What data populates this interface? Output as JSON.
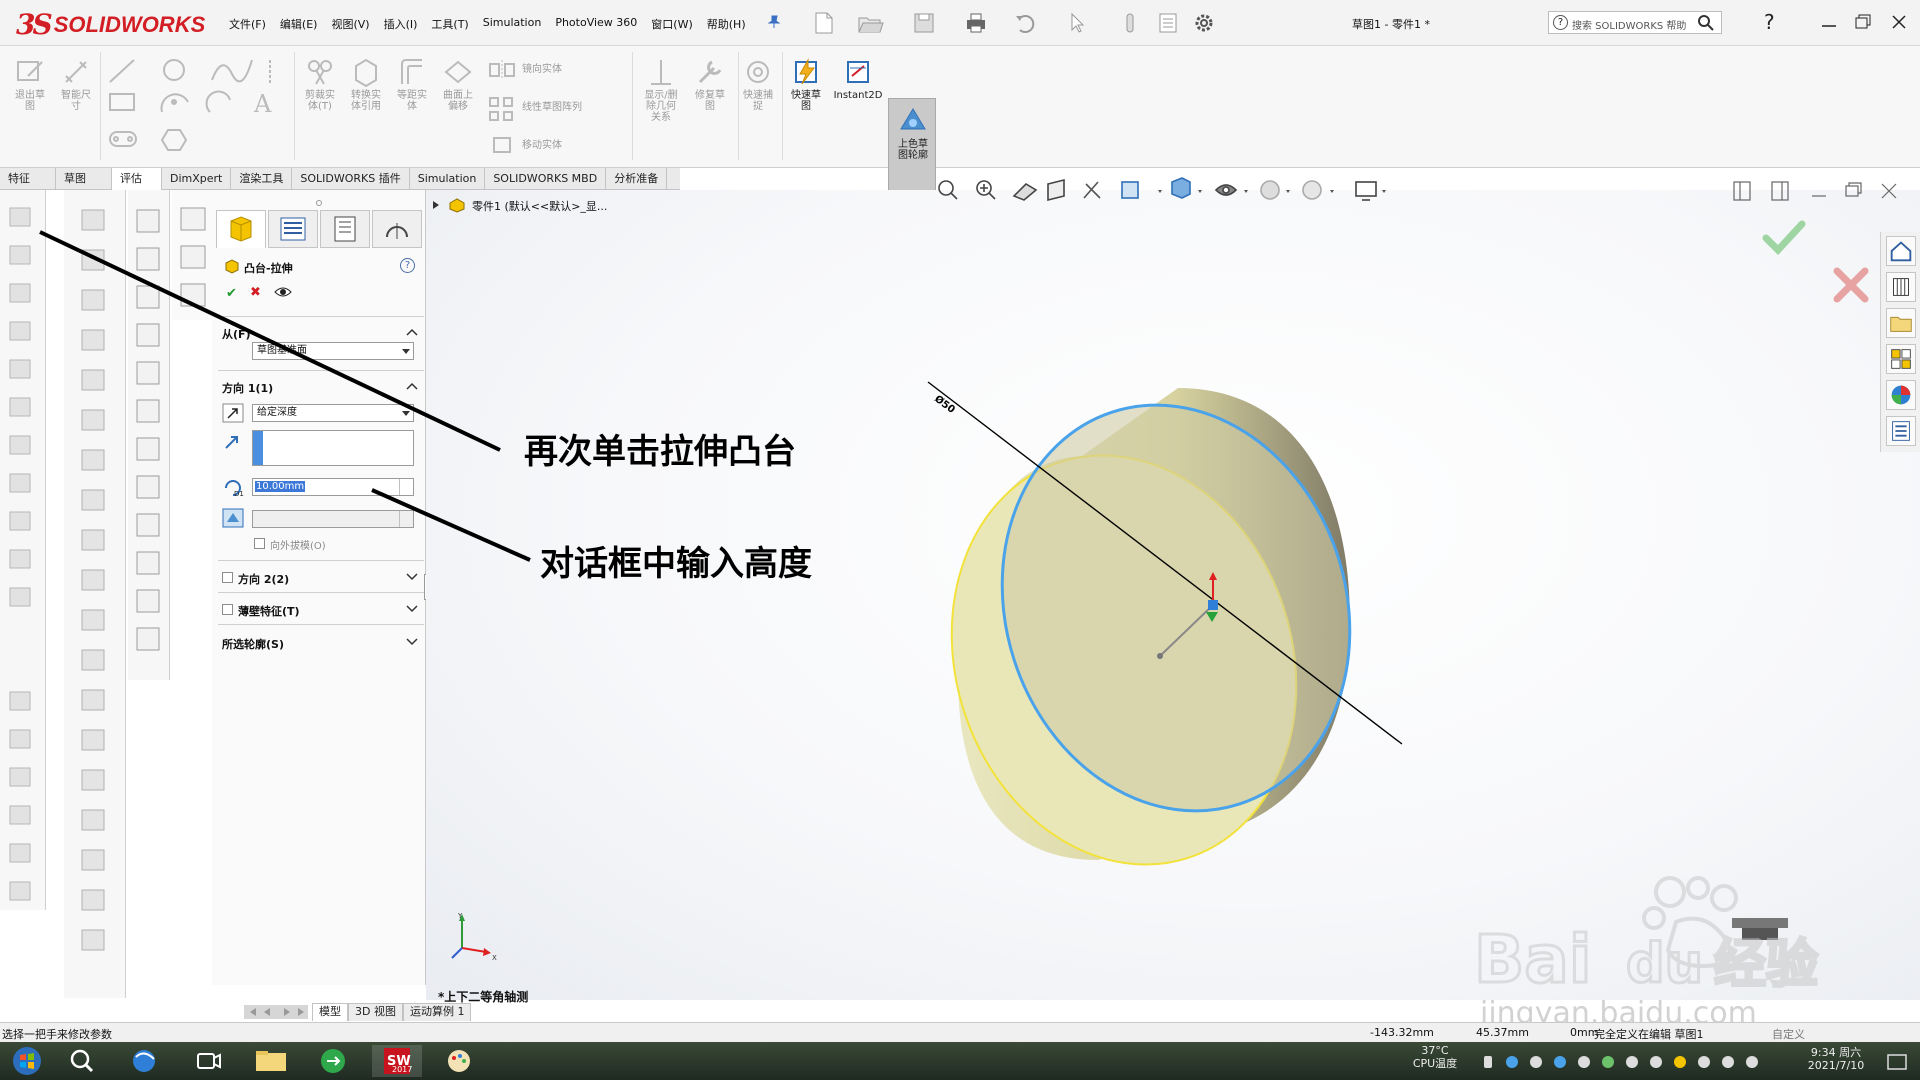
{
  "app": {
    "logo_text": "SOLIDWORKS",
    "document_title": "草图1 - 零件1 *"
  },
  "menu": [
    "文件(F)",
    "编辑(E)",
    "视图(V)",
    "插入(I)",
    "工具(T)",
    "Simulation",
    "PhotoView 360",
    "窗口(W)",
    "帮助(H)"
  ],
  "search": {
    "placeholder": "搜索 SOLIDWORKS 帮助"
  },
  "command_manager": {
    "buttons": [
      {
        "label": "退出草\n图"
      },
      {
        "label": "智能尺\n寸"
      },
      {
        "label": "剪裁实\n体(T)"
      },
      {
        "label": "转换实\n体引用"
      },
      {
        "label": "等距实\n体"
      },
      {
        "label": "曲面上\n偏移"
      },
      {
        "label": "镜向实体"
      },
      {
        "label": "线性草图阵列"
      },
      {
        "label": "移动实体"
      },
      {
        "label": "显示/删\n除几何\n关系"
      },
      {
        "label": "修复草\n图"
      },
      {
        "label": "快速捕\n捉"
      },
      {
        "label": "快速草\n图"
      },
      {
        "label": "Instant2D"
      },
      {
        "label": "上色草\n图轮廓"
      }
    ]
  },
  "tabs": [
    "特征",
    "草图",
    "评估",
    "DimXpert",
    "渲染工具",
    "SOLIDWORKS 插件",
    "Simulation",
    "SOLIDWORKS MBD",
    "分析准备"
  ],
  "property_manager": {
    "title": "凸台-拉伸",
    "help": "?",
    "from_section": {
      "header": "从(F)",
      "value": "草图基准面"
    },
    "direction1": {
      "header": "方向 1(1)",
      "end_condition": "给定深度",
      "depth": "10.00mm",
      "draft_outward": "向外拔模(O)"
    },
    "direction2": "方向 2(2)",
    "thin_feature": "薄壁特征(T)",
    "selected_contours": "所选轮廓(S)"
  },
  "viewport": {
    "tree_root": "零件1  (默认<<默认>_显...",
    "dimension": "Ø50",
    "view_name": "*上下二等角轴测"
  },
  "annotations": {
    "a1": "再次单击拉伸凸台",
    "a2": "对话框中输入高度"
  },
  "bottom_tabs": [
    "模型",
    "3D 视图",
    "运动算例 1"
  ],
  "status": {
    "hint": "选择一把手来修改参数",
    "x": "-143.32mm",
    "y": "45.37mm",
    "z": "0mm",
    "state": "完全定义",
    "editing": "在编辑 草图1",
    "custom": "自定义"
  },
  "taskbar": {
    "temp": "37°C",
    "temp_label": "CPU温度",
    "time": "9:34 周六",
    "date": "2021/7/10",
    "sw_badge": "2017"
  },
  "watermark": {
    "text": "Bai du 经验",
    "url": "jingyan.baidu.com"
  },
  "colors": {
    "brand": "#d21e24",
    "edge": "#4aa3ea",
    "face": "#e8e6b4",
    "selection": "#3c78d8"
  }
}
